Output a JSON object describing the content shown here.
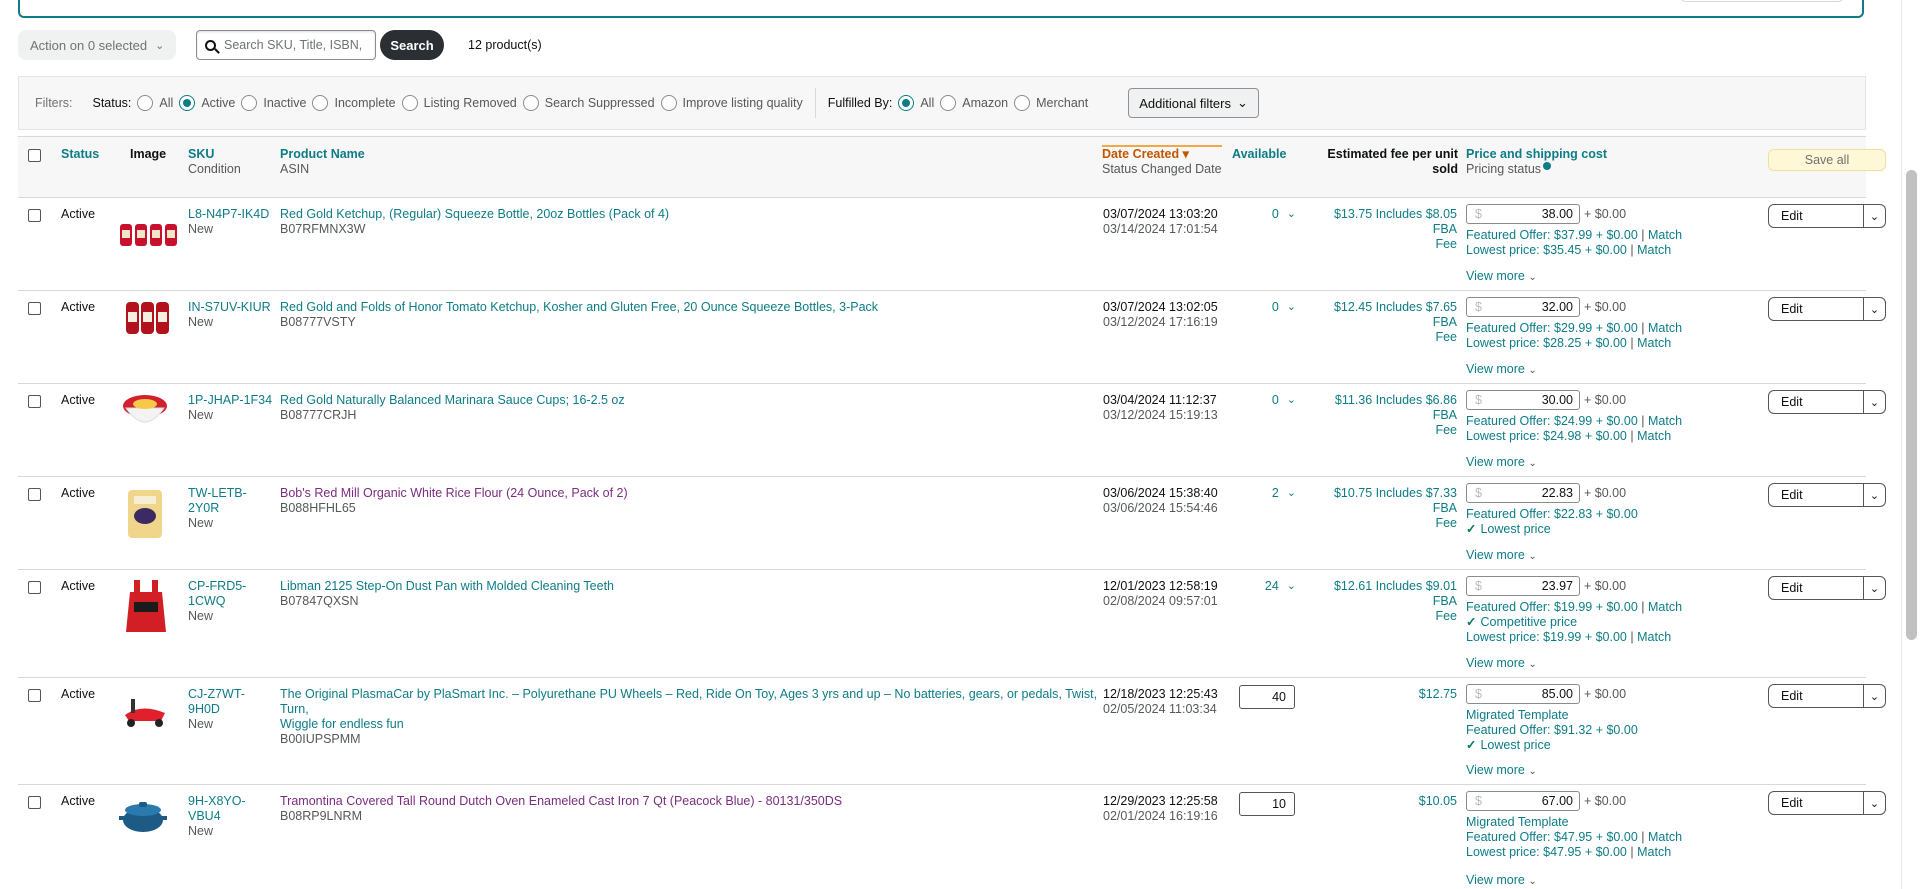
{
  "toolbar": {
    "action_label": "Action on 0 selected",
    "search_placeholder": "Search SKU, Title, ISBN,",
    "search_button": "Search",
    "count": "12 product(s)"
  },
  "filters": {
    "label": "Filters:",
    "status_label": "Status:",
    "status_options": [
      "All",
      "Active",
      "Inactive",
      "Incomplete",
      "Listing Removed",
      "Search Suppressed",
      "Improve listing quality"
    ],
    "fulfilled_label": "Fulfilled By:",
    "fulfilled_options": [
      "All",
      "Amazon",
      "Merchant"
    ],
    "additional": "Additional filters"
  },
  "header": {
    "status": "Status",
    "image": "Image",
    "sku": "SKU",
    "condition": "Condition",
    "product_name": "Product Name",
    "asin": "ASIN",
    "date_created": "Date Created",
    "status_changed": "Status Changed Date",
    "available": "Available",
    "fee": "Estimated fee per unit",
    "fee2": "sold",
    "price": "Price and shipping cost",
    "pricing_status": "Pricing status",
    "save_all": "Save all"
  },
  "rows": [
    {
      "status": "Active",
      "sku": "L8-N4P7-IK4D",
      "condition": "New",
      "name": "Red Gold Ketchup, (Regular) Squeeze Bottle, 20oz Bottles (Pack of 4)",
      "asin": "B07RFMNX3W",
      "created": "03/07/2024 13:03:20",
      "changed": "03/14/2024 17:01:54",
      "available": "0",
      "fee": "$13.75 Includes $8.05 FBA",
      "fee2": "Fee",
      "price": "38.00",
      "shipping": "+ $0.00",
      "line1": "Featured Offer: $37.99 + $0.00",
      "line1_match": "Match",
      "line2": "Lowest price: $35.45 + $0.00",
      "line2_match": "Match",
      "view_more": "View more",
      "edit": "Edit"
    },
    {
      "status": "Active",
      "sku": "IN-S7UV-KIUR",
      "condition": "New",
      "name": "Red Gold and Folds of Honor Tomato Ketchup, Kosher and Gluten Free, 20 Ounce Squeeze Bottles, 3-Pack",
      "asin": "B08777VSTY",
      "created": "03/07/2024 13:02:05",
      "changed": "03/12/2024 17:16:19",
      "available": "0",
      "fee": "$12.45 Includes $7.65 FBA",
      "fee2": "Fee",
      "price": "32.00",
      "shipping": "+ $0.00",
      "line1": "Featured Offer: $29.99 + $0.00",
      "line1_match": "Match",
      "line2": "Lowest price: $28.25 + $0.00",
      "line2_match": "Match",
      "view_more": "View more",
      "edit": "Edit"
    },
    {
      "status": "Active",
      "sku": "1P-JHAP-1F34",
      "condition": "New",
      "name": "Red Gold Naturally Balanced Marinara Sauce Cups; 16-2.5 oz",
      "asin": "B08777CRJH",
      "created": "03/04/2024 11:12:37",
      "changed": "03/12/2024 15:19:13",
      "available": "0",
      "fee": "$11.36 Includes $6.86 FBA",
      "fee2": "Fee",
      "price": "30.00",
      "shipping": "+ $0.00",
      "line1": "Featured Offer: $24.99 + $0.00",
      "line1_match": "Match",
      "line2": "Lowest price: $24.98 + $0.00",
      "line2_match": "Match",
      "view_more": "View more",
      "edit": "Edit"
    },
    {
      "status": "Active",
      "sku_a": "TW-LETB-",
      "sku_b": "2Y0R",
      "condition": "New",
      "name": "Bob's Red Mill Organic White Rice Flour (24 Ounce, Pack of 2)",
      "asin": "B088HFHL65",
      "created": "03/06/2024 15:38:40",
      "changed": "03/06/2024 15:54:46",
      "available": "2",
      "fee": "$10.75 Includes $7.33 FBA",
      "fee2": "Fee",
      "price": "22.83",
      "shipping": "+ $0.00",
      "line1": "Featured Offer: $22.83 + $0.00",
      "line2": "Lowest price",
      "view_more": "View more",
      "edit": "Edit"
    },
    {
      "status": "Active",
      "sku_a": "CP-FRD5-",
      "sku_b": "1CWQ",
      "condition": "New",
      "name": "Libman 2125 Step-On Dust Pan with Molded Cleaning Teeth",
      "asin": "B07847QXSN",
      "created": "12/01/2023 12:58:19",
      "changed": "02/08/2024 09:57:01",
      "available": "24",
      "fee": "$12.61 Includes $9.01 FBA",
      "fee2": "Fee",
      "price": "23.97",
      "shipping": "+ $0.00",
      "line1": "Featured Offer: $19.99 + $0.00",
      "line1_match": "Match",
      "line2": "Competitive price",
      "line3": "Lowest price: $19.99 + $0.00",
      "line3_match": "Match",
      "view_more": "View more",
      "edit": "Edit"
    },
    {
      "status": "Active",
      "sku_a": "CJ-Z7WT-",
      "sku_b": "9H0D",
      "condition": "New",
      "name_a": "The Original PlasmaCar by PlaSmart Inc. – Polyurethane PU Wheels – Red, Ride On Toy, Ages 3 yrs and up – No batteries, gears, or pedals, Twist, Turn,",
      "name_b": "Wiggle for endless fun",
      "asin": "B00IUPSPMM",
      "created": "12/18/2023 12:25:43",
      "changed": "02/05/2024 11:03:34",
      "available": "40",
      "fee": "$12.75",
      "price": "85.00",
      "shipping": "+ $0.00",
      "line1": "Migrated Template",
      "line2": "Featured Offer: $91.32 + $0.00",
      "line3": "Lowest price",
      "view_more": "View more",
      "edit": "Edit"
    },
    {
      "status": "Active",
      "sku_a": "9H-X8YO-",
      "sku_b": "VBU4",
      "condition": "New",
      "name": "Tramontina Covered Tall Round Dutch Oven Enameled Cast Iron 7 Qt (Peacock Blue) - 80131/350DS",
      "asin": "B08RP9LNRM",
      "created": "12/29/2023 12:25:58",
      "changed": "02/01/2024 16:19:16",
      "available": "10",
      "fee": "$10.05",
      "price": "67.00",
      "shipping": "+ $0.00",
      "line1": "Migrated Template",
      "line2": "Featured Offer: $47.95 + $0.00",
      "line2_match": "Match",
      "line3": "Lowest price: $47.95 + $0.00",
      "line3_match": "Match",
      "view_more": "View more",
      "edit": "Edit"
    }
  ],
  "icons": {
    "search": "search-icon",
    "chevron": "chevron-down-icon",
    "check": "check-icon",
    "info": "info-icon"
  },
  "colors": {
    "accent": "#0e7c86",
    "link": "#0e7c86",
    "visited": "#7b2c80",
    "sort": "#c45500"
  }
}
